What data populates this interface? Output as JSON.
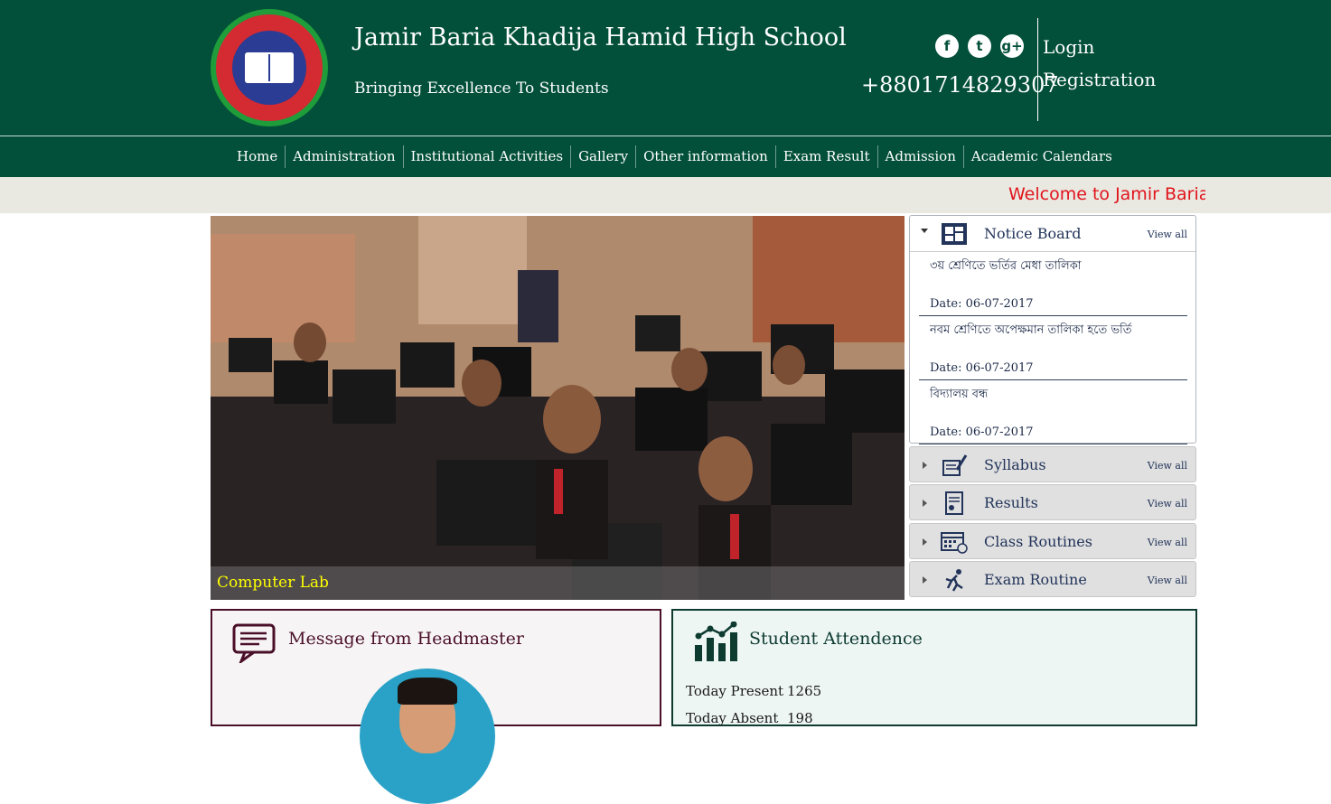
{
  "header": {
    "school_name": "Jamir Baria Khadija Hamid High School",
    "tagline": "Bringing Excellence To Students",
    "phone": "+8801714829307",
    "social": [
      {
        "icon": "facebook-icon",
        "glyph": "f"
      },
      {
        "icon": "twitter-icon",
        "glyph": "t"
      },
      {
        "icon": "google-plus-icon",
        "glyph": "g+"
      }
    ],
    "login_label": "Login",
    "registration_label": "Registration"
  },
  "nav": {
    "items": [
      "Home",
      "Administration",
      "Institutional Activities",
      "Gallery",
      "Other information",
      "Exam Result",
      "Admission",
      "Academic Calendars"
    ]
  },
  "marquee": {
    "text": "Welcome to Jamir Baria",
    "color": "#e1141c"
  },
  "slider": {
    "caption": "Computer Lab"
  },
  "notice_board": {
    "title": "Notice Board",
    "view_all": "View all",
    "notices": [
      {
        "title": "৩য় শ্রেণিতে ভর্তির মেধা তালিকা",
        "date": "Date: 06-07-2017"
      },
      {
        "title": "নবম শ্রেণিতে অপেক্ষমান তালিকা হতে ভর্তি",
        "date": "Date: 06-07-2017"
      },
      {
        "title": "বিদ্যালয় বন্ধ",
        "date": "Date: 06-07-2017"
      }
    ]
  },
  "panels": [
    {
      "title": "Syllabus",
      "view_all": "View all",
      "icon": "syllabus-icon"
    },
    {
      "title": "Results",
      "view_all": "View all",
      "icon": "results-icon"
    },
    {
      "title": "Class Routines",
      "view_all": "View all",
      "icon": "calendar-icon"
    },
    {
      "title": "Exam Routine",
      "view_all": "View all",
      "icon": "exam-runner-icon"
    }
  ],
  "message": {
    "title": "Message from Headmaster"
  },
  "attendance": {
    "title": "Student Attendence",
    "rows": [
      {
        "label": "Today Present",
        "value": "1265"
      },
      {
        "label": "Today Absent",
        "value": "198"
      }
    ]
  },
  "colors": {
    "header_bg": "#03503a",
    "caption": "#ffff00",
    "message_border": "#4a0f28"
  }
}
